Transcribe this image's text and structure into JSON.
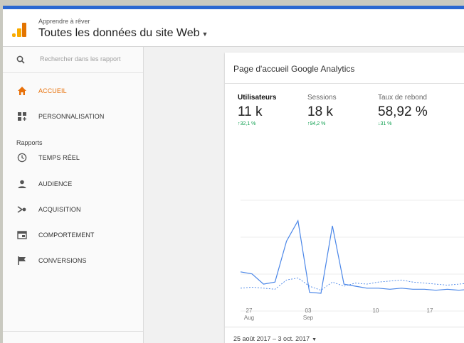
{
  "header": {
    "account_sub": "Apprendre à rêver",
    "account_main": "Toutes les données du site Web",
    "caret": "▼"
  },
  "sidebar": {
    "search_placeholder": "Rechercher dans les rapport",
    "section_label": "Rapports",
    "items": [
      {
        "label": "ACCUEIL",
        "icon": "home-icon",
        "active": true
      },
      {
        "label": "PERSONNALISATION",
        "icon": "dashboard-icon",
        "active": false
      },
      {
        "label": "TEMPS RÉEL",
        "icon": "clock-icon",
        "active": false
      },
      {
        "label": "AUDIENCE",
        "icon": "person-icon",
        "active": false
      },
      {
        "label": "ACQUISITION",
        "icon": "acquisition-icon",
        "active": false
      },
      {
        "label": "COMPORTEMENT",
        "icon": "behavior-icon",
        "active": false
      },
      {
        "label": "CONVERSIONS",
        "icon": "flag-icon",
        "active": false
      }
    ]
  },
  "card": {
    "title": "Page d'accueil Google Analytics",
    "metrics": [
      {
        "label": "Utilisateurs",
        "value": "11 k",
        "change": "↑32,1 %"
      },
      {
        "label": "Sessions",
        "value": "18 k",
        "change": "↑94,2 %"
      },
      {
        "label": "Taux de rebond",
        "value": "58,92 %",
        "change": "↓31 %"
      }
    ],
    "date_range": "25 août 2017 – 3 oct. 2017"
  },
  "colors": {
    "accent_blue": "#2a67d1",
    "active_orange": "#e8710a",
    "positive_green": "#0a9d4c",
    "line_current": "#4a86e8",
    "line_previous": "#4a86e8"
  },
  "chart_data": {
    "type": "line",
    "x_ticks": [
      {
        "day": "27",
        "month": "Aug"
      },
      {
        "day": "03",
        "month": "Sep"
      },
      {
        "day": "10",
        "month": ""
      },
      {
        "day": "17",
        "month": ""
      }
    ],
    "grid": true,
    "series": [
      {
        "style": "solid",
        "values": [
          30,
          28,
          18,
          20,
          60,
          80,
          10,
          9,
          75,
          18,
          16,
          14,
          14,
          13,
          14,
          13,
          13,
          12,
          13,
          12,
          13,
          12,
          13,
          12,
          12,
          13,
          12,
          13,
          12,
          13,
          12,
          13,
          12,
          13,
          12,
          13,
          12,
          13,
          12,
          13,
          12,
          13,
          12
        ]
      },
      {
        "style": "dashed",
        "values": [
          14,
          15,
          14,
          13,
          22,
          24,
          16,
          12,
          20,
          16,
          19,
          18,
          20,
          21,
          22,
          20,
          19,
          18,
          17,
          18,
          19,
          20,
          21,
          20,
          19,
          17,
          16,
          17,
          18,
          19,
          22,
          25,
          20,
          18,
          24,
          26,
          22,
          20,
          19,
          18,
          17,
          16,
          15
        ]
      }
    ]
  }
}
